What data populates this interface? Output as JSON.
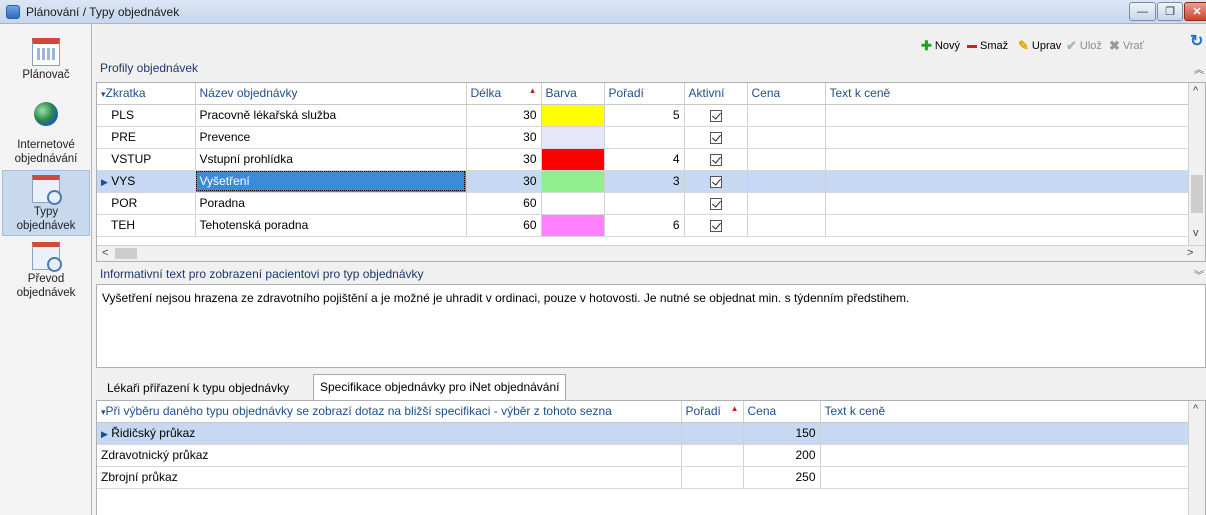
{
  "window": {
    "title": "Plánování / Typy objednávek",
    "min_glyph": "—",
    "max_glyph": "❐",
    "close_glyph": "✕"
  },
  "sidebar": {
    "items": [
      {
        "label": "Plánovač",
        "icon": "calendar-icon",
        "active": false
      },
      {
        "label": "Internetové objednávání",
        "icon": "globe-icon",
        "active": false
      },
      {
        "label": "Typy objednávek",
        "icon": "order-types-icon",
        "active": true
      },
      {
        "label": "Převod objednávek",
        "icon": "order-transfer-icon",
        "active": false
      }
    ]
  },
  "toolbar": {
    "new_label": "Nový",
    "delete_label": "Smaž",
    "edit_label": "Uprav",
    "save_label": "Ulož",
    "revert_label": "Vrať",
    "new_glyph": "✚",
    "delete_glyph": "▬",
    "edit_glyph": "✎",
    "save_glyph": "✔",
    "revert_glyph": "✖",
    "refresh_glyph": "↻",
    "colors": {
      "new": "#2aa02a",
      "delete": "#d42020",
      "edit": "#e0a800"
    }
  },
  "profiles": {
    "section_label": "Profily objednávek",
    "collapse_glyph": "︽",
    "columns": [
      "Zkratka",
      "Název objednávky",
      "Délka",
      "Barva",
      "Pořadí",
      "Aktivní",
      "Cena",
      "Text k ceně"
    ],
    "sort_glyph": "▲",
    "filter_glyph": "▾",
    "row_marker": "▶",
    "rows": [
      {
        "code": "PLS",
        "name": "Pracovně lékařská služba",
        "length": "30",
        "color": "#ffff00",
        "order": "5",
        "active": true,
        "price": "",
        "price_text": "",
        "selected": false
      },
      {
        "code": "PRE",
        "name": "Prevence",
        "length": "30",
        "color": "#e6e6fa",
        "order": "",
        "active": true,
        "price": "",
        "price_text": "",
        "selected": false
      },
      {
        "code": "VSTUP",
        "name": "Vstupní prohlídka",
        "length": "30",
        "color": "#ff0000",
        "order": "4",
        "active": true,
        "price": "",
        "price_text": "",
        "selected": false
      },
      {
        "code": "VYS",
        "name": "Vyšetření",
        "length": "30",
        "color": "#90ee90",
        "order": "3",
        "active": true,
        "price": "",
        "price_text": "",
        "selected": true
      },
      {
        "code": "POR",
        "name": "Poradna",
        "length": "60",
        "color": "#ffffff",
        "order": "",
        "active": true,
        "price": "",
        "price_text": "",
        "selected": false
      },
      {
        "code": "TEH",
        "name": "Tehotenská poradna",
        "length": "60",
        "color": "#ff80ff",
        "order": "6",
        "active": true,
        "price": "",
        "price_text": "",
        "selected": false
      }
    ]
  },
  "info": {
    "section_label": "Informativní text pro zobrazení pacientovi pro typ objednávky",
    "expand_glyph": "︾",
    "text": "Vyšetření nejsou hrazena ze zdravotního pojištění a je možné je uhradit v ordinaci, pouze v hotovosti. Je nutné se objednat min. s týdenním předstihem."
  },
  "tabs": [
    {
      "label": "Lékaři přiřazení k typu objednávky",
      "active": false
    },
    {
      "label": "Specifikace objednávky pro iNet objednávání",
      "active": true
    }
  ],
  "spec": {
    "columns": [
      "Při výběru daného typu objednávky se zobrazí dotaz na bližší specifikaci - výběr z tohoto sezna",
      "Pořadí",
      "Cena",
      "Text k ceně"
    ],
    "rows": [
      {
        "name": "Řidičský průkaz",
        "order": "",
        "price": "150",
        "price_text": "",
        "selected": true
      },
      {
        "name": "Zdravotnický průkaz",
        "order": "",
        "price": "200",
        "price_text": "",
        "selected": false
      },
      {
        "name": "Zbrojní průkaz",
        "order": "",
        "price": "250",
        "price_text": "",
        "selected": false
      }
    ]
  },
  "scroll": {
    "up": "^",
    "down": "v",
    "left": "<",
    "right": ">"
  }
}
